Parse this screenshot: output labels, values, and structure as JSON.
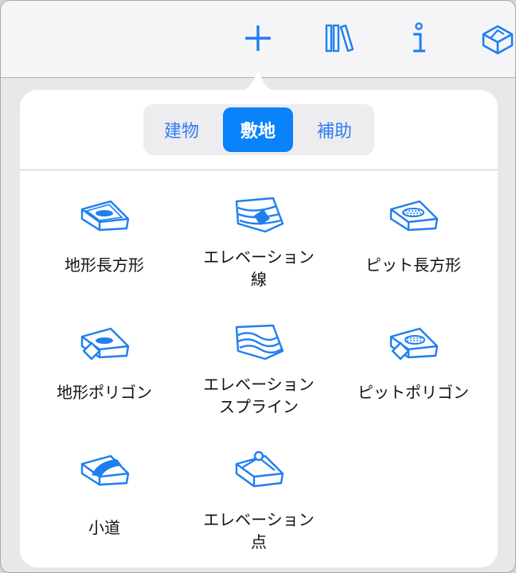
{
  "toolbar": {
    "items": [
      {
        "name": "add",
        "icon": "plus-icon"
      },
      {
        "name": "library",
        "icon": "books-icon"
      },
      {
        "name": "info",
        "icon": "info-icon"
      },
      {
        "name": "model",
        "icon": "house-box-icon"
      }
    ]
  },
  "segments": [
    {
      "label": "建物",
      "selected": false
    },
    {
      "label": "敷地",
      "selected": true
    },
    {
      "label": "補助",
      "selected": false
    }
  ],
  "tools": [
    {
      "label1": "地形長方形",
      "label2": "",
      "icon": "terrain-rectangle-icon"
    },
    {
      "label1": "エレベーション",
      "label2": "線",
      "icon": "elevation-line-icon"
    },
    {
      "label1": "ピット長方形",
      "label2": "",
      "icon": "pit-rectangle-icon"
    },
    {
      "label1": "地形ポリゴン",
      "label2": "",
      "icon": "terrain-polygon-icon"
    },
    {
      "label1": "エレベーション",
      "label2": "スプライン",
      "icon": "elevation-spline-icon"
    },
    {
      "label1": "ピットポリゴン",
      "label2": "",
      "icon": "pit-polygon-icon"
    },
    {
      "label1": "小道",
      "label2": "",
      "icon": "path-icon"
    },
    {
      "label1": "エレベーション",
      "label2": "点",
      "icon": "elevation-point-icon"
    }
  ],
  "colors": {
    "accent": "#0a82fa",
    "icon": "#1e7ff0",
    "text": "#111111"
  }
}
